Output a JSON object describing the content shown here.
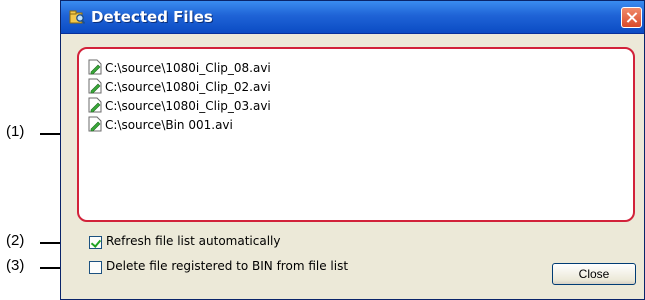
{
  "window": {
    "title": "Detected Files",
    "icon": "folder-search-icon",
    "close_icon": "close-icon"
  },
  "file_list": {
    "items": [
      {
        "icon": "file-icon",
        "path": "C:\\source\\1080i_Clip_08.avi"
      },
      {
        "icon": "file-icon",
        "path": "C:\\source\\1080i_Clip_02.avi"
      },
      {
        "icon": "file-icon",
        "path": "C:\\source\\1080i_Clip_03.avi"
      },
      {
        "icon": "file-icon",
        "path": "C:\\source\\Bin 001.avi"
      }
    ],
    "highlight_color": "#d2223a"
  },
  "options": {
    "refresh": {
      "label": "Refresh file list automatically",
      "checked": true
    },
    "delete_registered": {
      "label": "Delete file registered to BIN from file list",
      "checked": false
    }
  },
  "buttons": {
    "close_label": "Close"
  },
  "callouts": {
    "one": "(1)",
    "two": "(2)",
    "three": "(3)"
  }
}
